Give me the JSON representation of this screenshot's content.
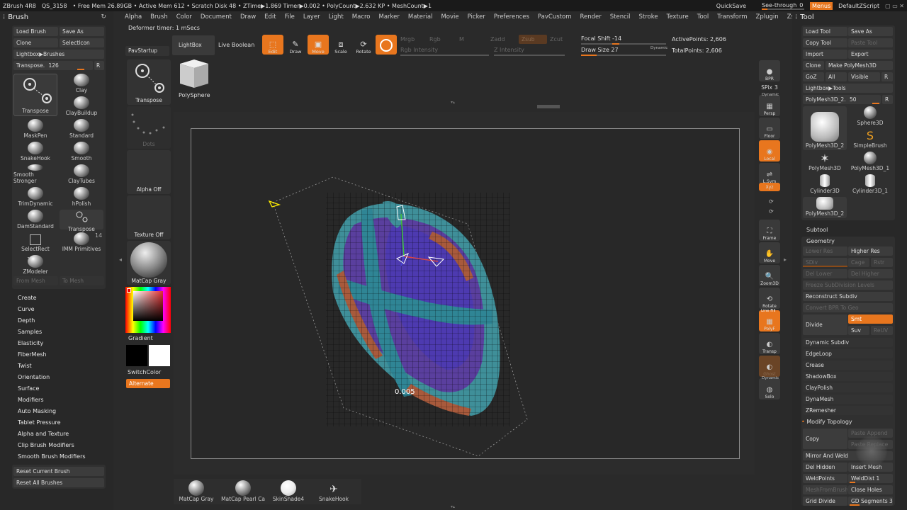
{
  "topbar": {
    "app": "ZBrush 4R8",
    "qs": "QS_3158",
    "stats": "• Free Mem 26.89GB • Active Mem 612 • Scratch Disk 48 • ZTime▶1.869 Timer▶0.002 • PolyCount▶2.632 KP • MeshCount▶1",
    "quicksave": "QuickSave",
    "seethrough": "See-through",
    "seethrough_val": "0",
    "menus": "Menus",
    "script": "DefaultZScript"
  },
  "menu": [
    "Alpha",
    "Brush",
    "Color",
    "Document",
    "Draw",
    "Edit",
    "File",
    "Layer",
    "Light",
    "Macro",
    "Marker",
    "Material",
    "Movie",
    "Picker",
    "Preferences",
    "PavCustom",
    "Render",
    "Stencil",
    "Stroke",
    "Texture",
    "Tool",
    "Transform",
    "Zplugin",
    "Zscript"
  ],
  "brush_panel": {
    "title": "Brush",
    "load": "Load Brush",
    "saveas": "Save As",
    "clone": "Clone",
    "selecticon": "SelectIcon",
    "lightbox": "Lightbox▶Brushes",
    "transpose_label": "Transpose.",
    "transpose_val": "126",
    "r": "R",
    "brushes": [
      {
        "name": "Transpose",
        "icon": "transpose-icon"
      },
      {
        "name": "Clay",
        "icon": "clay-icon"
      },
      {
        "name": "ClayBuildup",
        "icon": "claybuildup-icon"
      },
      {
        "name": "MaskPen",
        "icon": "maskpen-icon"
      },
      {
        "name": "Standard",
        "icon": "standard-icon"
      },
      {
        "name": "SnakeHook",
        "icon": "snakehook-icon"
      },
      {
        "name": "Smooth",
        "icon": "smooth-icon"
      },
      {
        "name": "Smooth Stronger",
        "icon": "smooth-stronger-icon"
      },
      {
        "name": "ClayTubes",
        "icon": "claytubes-icon"
      },
      {
        "name": "TrimDynamic",
        "icon": "trimdynamic-icon"
      },
      {
        "name": "hPolish",
        "icon": "hpolish-icon"
      },
      {
        "name": "DamStandard",
        "icon": "damstandard-icon"
      },
      {
        "name": "Transpose",
        "icon": "transpose-small-icon"
      },
      {
        "name": "SelectRect",
        "icon": "selectrect-icon"
      },
      {
        "name": "IMM Primitives",
        "icon": "imm-icon"
      },
      {
        "name": "ZModeler",
        "icon": "zmodeler-icon"
      }
    ],
    "imm_count": "14",
    "zm_count": "1",
    "from_mesh": "From Mesh",
    "to_mesh": "To Mesh",
    "sections": [
      "Create",
      "Curve",
      "Depth",
      "Samples",
      "Elasticity",
      "FiberMesh",
      "Twist",
      "Orientation",
      "Surface",
      "Modifiers",
      "Auto Masking",
      "Tablet Pressure",
      "Alpha and Texture",
      "Clip Brush Modifiers",
      "Smooth Brush Modifiers"
    ],
    "reset_current": "Reset Current Brush",
    "reset_all": "Reset All Brushes"
  },
  "toolbar": {
    "deformer": "Deformer timer: 1 mSecs",
    "pavstartup": "PavStartup",
    "lightbox": "LightBox",
    "liveboolean": "Live Boolean",
    "edit": "Edit",
    "draw": "Draw",
    "move": "Move",
    "scale": "Scale",
    "rotate": "Rotate",
    "mrgb": "Mrgb",
    "rgb": "Rgb",
    "m": "M",
    "zadd": "Zadd",
    "zsub": "Zsub",
    "zcut": "Zcut",
    "rgb_intensity": "Rgb Intensity",
    "z_intensity": "Z Intensity",
    "focal_label": "Focal Shift",
    "focal_val": "-14",
    "drawsize_label": "Draw Size",
    "drawsize_val": "27",
    "dynamic": "Dynamic",
    "active_points": "ActivePoints: 2,606",
    "total_points": "TotalPoints: 2,606"
  },
  "left_shelf": {
    "transpose": "Transpose",
    "dots": "Dots",
    "alpha_off": "Alpha Off",
    "texture_off": "Texture Off",
    "matcap": "MatCap Gray",
    "gradient": "Gradient",
    "switchcolor": "SwitchColor",
    "alternate": "Alternate",
    "polysphere": "PolySphere"
  },
  "canvas": {
    "measure": "0.005"
  },
  "right_shelf": {
    "bpr": "BPR",
    "spix_label": "SPix",
    "spix_val": "3",
    "dynamic": "Dynamic",
    "persp": "Persp",
    "floor": "Floor",
    "local": "Local",
    "lsym": "L.Sym",
    "xyz": "Xyz",
    "frame": "Frame",
    "move": "Move",
    "zoom3d": "Zoom3D",
    "rotate": "Rotate",
    "linefill": "Line Fill",
    "polyf": "PolyF",
    "transp": "Transp",
    "ghost": "Ghost",
    "solo": "Solo",
    "dyn2": "Dynamic"
  },
  "tool_panel": {
    "title": "Tool",
    "load": "Load Tool",
    "saveas": "Save As",
    "copy": "Copy Tool",
    "paste": "Paste Tool",
    "import": "Import",
    "export": "Export",
    "clone": "Clone",
    "make": "Make PolyMesh3D",
    "goz": "GoZ",
    "all": "All",
    "visible": "Visible",
    "r": "R",
    "lightbox": "Lightbox▶Tools",
    "current_label": "PolyMesh3D_2.",
    "current_val": "50",
    "tools": [
      {
        "name": "PolyMesh3D_2",
        "icon": "polymesh-icon"
      },
      {
        "name": "Sphere3D",
        "icon": "sphere3d-icon"
      },
      {
        "name": "SimpleBrush",
        "icon": "simplebrush-icon"
      },
      {
        "name": "PolyMesh3D",
        "icon": "polymesh-star-icon"
      },
      {
        "name": "PolyMesh3D_1",
        "icon": "polymesh1-icon"
      },
      {
        "name": "Cylinder3D",
        "icon": "cylinder-icon"
      },
      {
        "name": "Cylinder3D_1",
        "icon": "cylinder1-icon"
      },
      {
        "name": "PolyMesh3D_2",
        "icon": "polymesh2-icon"
      }
    ],
    "subtool": "Subtool",
    "geometry": "Geometry",
    "lower_res": "Lower Res",
    "higher_res": "Higher Res",
    "sdiv": "SDiv",
    "cage": "Cage",
    "rstr": "Rstr",
    "del_lower": "Del Lower",
    "del_higher": "Del Higher",
    "freeze": "Freeze SubDivision Levels",
    "reconstruct": "Reconstruct Subdiv",
    "convert_bpr": "Convert BPR To Geo",
    "divide": "Divide",
    "smt": "Smt",
    "suv": "Suv",
    "reuv": "ReUV",
    "items": [
      "Dynamic Subdiv",
      "EdgeLoop",
      "Crease",
      "ShadowBox",
      "ClayPolish",
      "DynaMesh",
      "ZRemesher"
    ],
    "modify": "Modify Topology",
    "copy2": "Copy",
    "paste_append": "Paste Append",
    "paste_replace": "Paste Replace",
    "mirror_weld": "Mirror And Weld",
    "del_hidden": "Del Hidden",
    "insert_mesh": "Insert Mesh",
    "weldpoints": "WeldPoints",
    "weld_dist": "WeldDist 1",
    "meshfrombrush": "MeshFromBrush",
    "close_holes": "Close Holes",
    "grid_divide": "Grid Divide",
    "gd_label": "GD Segments",
    "gd_val": "3"
  },
  "bottom_materials": [
    {
      "name": "MatCap Gray",
      "icon": "matcap-gray-icon"
    },
    {
      "name": "MatCap Pearl Ca",
      "icon": "matcap-pearl-icon"
    },
    {
      "name": "SkinShade4",
      "icon": "skinshade-icon"
    },
    {
      "name": "SnakeHook",
      "icon": "snakehook-brush-icon"
    }
  ],
  "colors": {
    "accent": "#e8761e",
    "bg": "#2a2a2a",
    "panel": "#2e2e2e",
    "button": "#3c3c3c"
  }
}
